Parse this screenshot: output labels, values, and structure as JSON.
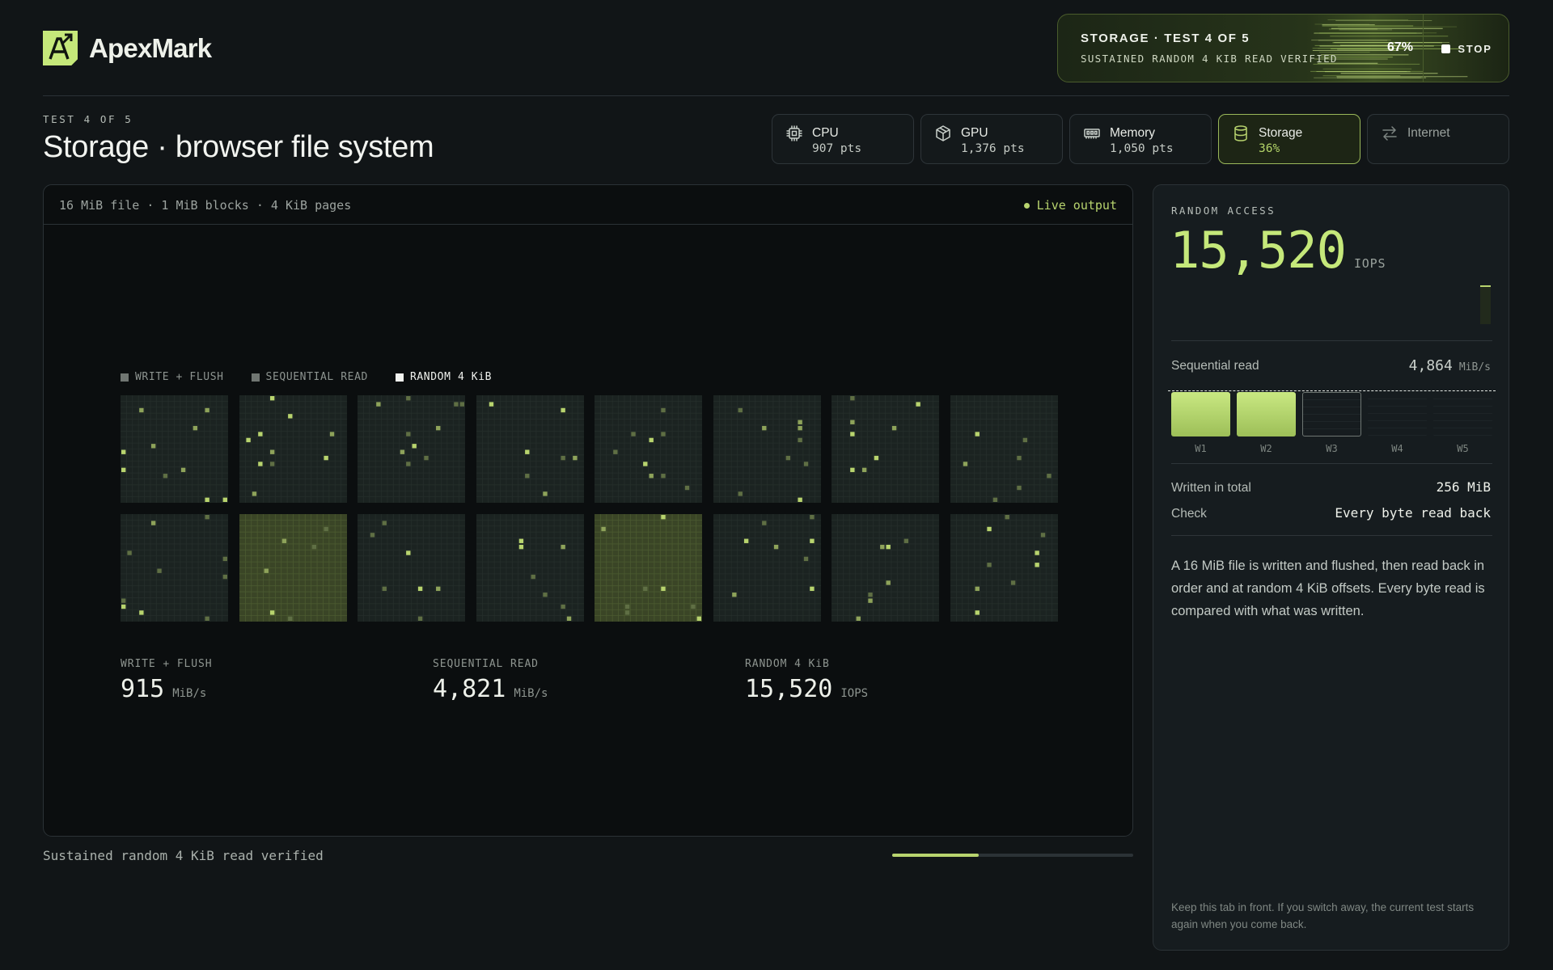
{
  "app": {
    "name": "ApexMark",
    "logo_letter": "A"
  },
  "run_status": {
    "title": "STORAGE · TEST 4 OF 5",
    "subtitle": "SUSTAINED RANDOM 4 KIB READ VERIFIED",
    "percent": "67%",
    "stop_label": "STOP"
  },
  "page": {
    "eyebrow": "TEST 4 OF 5",
    "title": "Storage · browser file system"
  },
  "tabs": [
    {
      "label": "CPU",
      "value": "907 pts",
      "icon": "chip-icon",
      "state": "done"
    },
    {
      "label": "GPU",
      "value": "1,376 pts",
      "icon": "cube-icon",
      "state": "done"
    },
    {
      "label": "Memory",
      "value": "1,050 pts",
      "icon": "memory-icon",
      "state": "done"
    },
    {
      "label": "Storage",
      "value": "36%",
      "icon": "database-icon",
      "state": "active"
    },
    {
      "label": "Internet",
      "value": "",
      "icon": "transfer-icon",
      "state": "pending"
    }
  ],
  "main": {
    "meta": "16 MiB file · 1 MiB blocks · 4 KiB pages",
    "live_label": "Live output",
    "legend": [
      {
        "label": "WRITE + FLUSH",
        "active": false
      },
      {
        "label": "SEQUENTIAL READ",
        "active": false
      },
      {
        "label": "RANDOM 4 KiB",
        "active": true
      }
    ],
    "stats": [
      {
        "label": "WRITE + FLUSH",
        "value": "915",
        "unit": "MiB/s"
      },
      {
        "label": "SEQUENTIAL READ",
        "value": "4,821",
        "unit": "MiB/s"
      },
      {
        "label": "RANDOM 4 KiB",
        "value": "15,520",
        "unit": "IOPS"
      }
    ]
  },
  "footer": {
    "status": "Sustained random 4 KiB read verified",
    "progress_fraction": 0.36
  },
  "side": {
    "eyebrow": "RANDOM ACCESS",
    "value": "15,520",
    "unit": "IOPS",
    "seq_label": "Sequential read",
    "seq_value": "4,864",
    "seq_unit": "MiB/s",
    "windows": [
      {
        "label": "W1",
        "state": "done"
      },
      {
        "label": "W2",
        "state": "done"
      },
      {
        "label": "W3",
        "state": "current"
      },
      {
        "label": "W4",
        "state": "pending"
      },
      {
        "label": "W5",
        "state": "pending"
      }
    ],
    "written_label": "Written in total",
    "written_value": "256 MiB",
    "check_label": "Check",
    "check_value": "Every byte read back",
    "description": "A 16 MiB file is written and flushed, then read back in order and at random 4 KiB offsets. Every byte read is compared with what was written.",
    "note": "Keep this tab in front. If you switch away, the current test starts again when you come back."
  },
  "colors": {
    "accent": "#c5e87a",
    "accent_dim": "#b8d46e",
    "background": "#111517",
    "panel": "#0b0e0f"
  }
}
